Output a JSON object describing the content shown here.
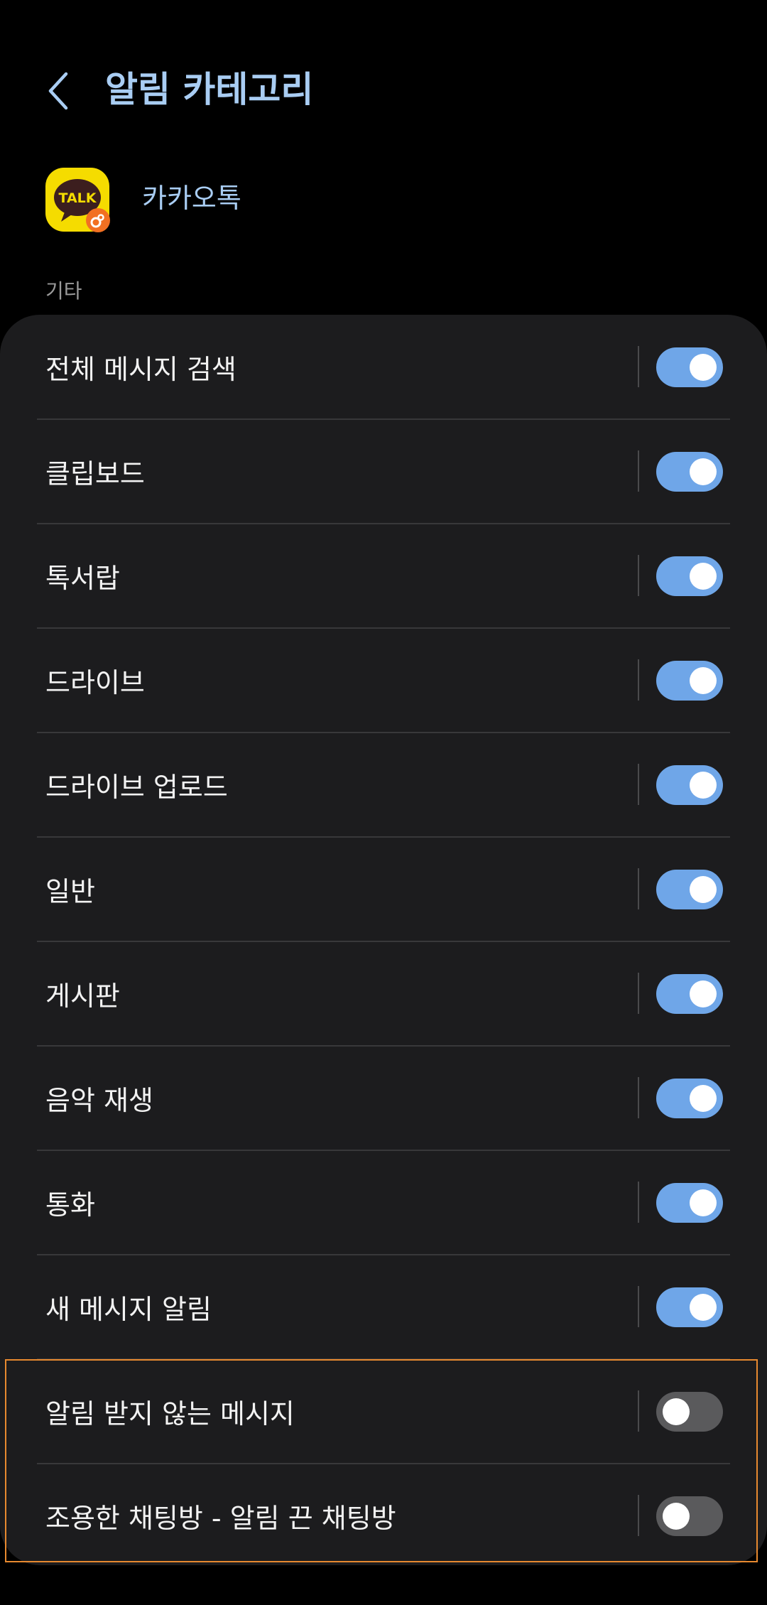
{
  "header": {
    "title": "알림 카테고리",
    "back_icon": "chevron-left-icon"
  },
  "app": {
    "name": "카카오톡",
    "icon_text": "TALK",
    "icon_name": "kakaotalk-app-icon"
  },
  "section": {
    "label": "기타"
  },
  "categories": [
    {
      "label": "전체 메시지 검색",
      "enabled": true
    },
    {
      "label": "클립보드",
      "enabled": true
    },
    {
      "label": "톡서랍",
      "enabled": true
    },
    {
      "label": "드라이브",
      "enabled": true
    },
    {
      "label": "드라이브 업로드",
      "enabled": true
    },
    {
      "label": "일반",
      "enabled": true
    },
    {
      "label": "게시판",
      "enabled": true
    },
    {
      "label": "음악 재생",
      "enabled": true
    },
    {
      "label": "통화",
      "enabled": true
    },
    {
      "label": "새 메시지 알림",
      "enabled": true
    },
    {
      "label": "알림 받지 않는 메시지",
      "enabled": false
    },
    {
      "label": "조용한 채팅방 - 알림 끈 채팅방",
      "enabled": false
    }
  ],
  "colors": {
    "background": "#000000",
    "card": "#1c1c1e",
    "accent_text": "#a9cdf3",
    "toggle_on": "#6fa6e8",
    "toggle_off": "#5a5a5c",
    "highlight": "#e7892f"
  }
}
